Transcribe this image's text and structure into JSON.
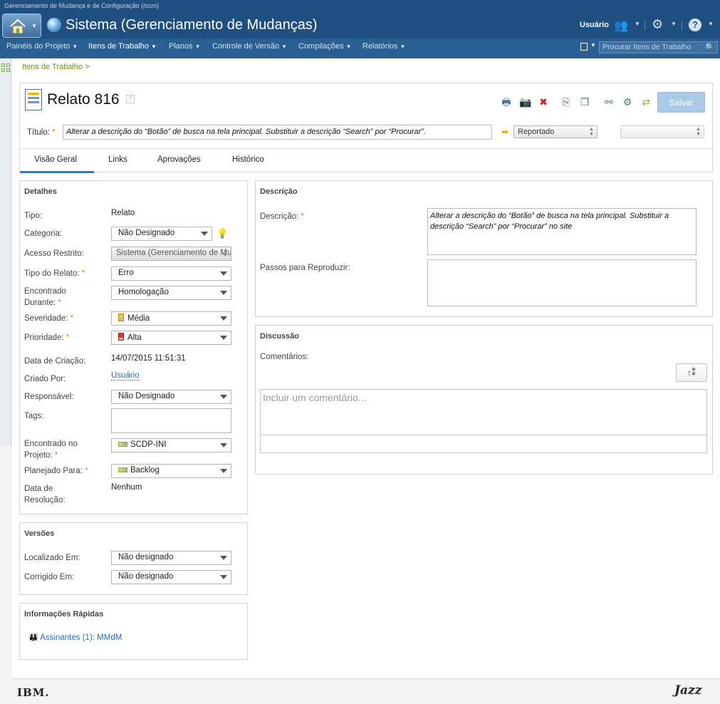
{
  "app": {
    "window_title": "Gerenciamento de Mudança e de Configuração (/ccm)",
    "project_title": "Sistema (Gerenciamento de Mudanças)",
    "user_label": "Usuário"
  },
  "nav": {
    "items": [
      {
        "label": "Painéis do Projeto"
      },
      {
        "label": "Itens de Trabalho"
      },
      {
        "label": "Planos"
      },
      {
        "label": "Controle de Versão"
      },
      {
        "label": "Compilações"
      },
      {
        "label": "Relatórios"
      }
    ],
    "search_placeholder": "Procurar Itens de Trabalho"
  },
  "breadcrumb": "Itens de Trabalho >",
  "work_item": {
    "title": "Relato 816",
    "help": "?",
    "title_label": "Título:",
    "title_value": "Alterar a descrição do “Botão” de busca na tela principal. Substituir a descrição “Search” por “Procurar”.",
    "state": "Reportado",
    "save_label": "Salvar"
  },
  "tabs": [
    {
      "label": "Visão Geral"
    },
    {
      "label": "Links"
    },
    {
      "label": "Aprovações"
    },
    {
      "label": "Histórico"
    }
  ],
  "details": {
    "header": "Detalhes",
    "fields": {
      "tipo": {
        "label": "Tipo:",
        "value": "Relato"
      },
      "categoria": {
        "label": "Categoria:",
        "value": "Não Designado"
      },
      "acesso": {
        "label": "Acesso Restrito:",
        "value": "Sistema (Gerenciamento de Mudanças)"
      },
      "tipo_relato": {
        "label": "Tipo do Relato:",
        "value": "Erro"
      },
      "encontrado_durante": {
        "label1": "Encontrado",
        "label2": "Durante:",
        "value": "Homologação"
      },
      "severidade": {
        "label": "Severidade:",
        "value": "Média"
      },
      "prioridade": {
        "label": "Prioridade:",
        "value": "Alta"
      },
      "data_criacao": {
        "label": "Data de Criação:",
        "value": "14/07/2015 11:51:31"
      },
      "criado_por": {
        "label": "Criado Por:",
        "value": "Usuário"
      },
      "responsavel": {
        "label": "Responsável:",
        "value": "Não Designado"
      },
      "tags": {
        "label": "Tags:",
        "value": ""
      },
      "encontrado_projeto": {
        "label1": "Encontrado no",
        "label2": "Projeto:",
        "value": "SCDP-INI"
      },
      "planejado_para": {
        "label": "Planejado Para:",
        "value": "Backlog"
      },
      "data_resolucao": {
        "label1": "Data de",
        "label2": "Resolução:",
        "value": "Nenhum"
      }
    }
  },
  "versions": {
    "header": "Versões",
    "localizado": {
      "label": "Localizado Em:",
      "value": "Não designado"
    },
    "corrigido": {
      "label": "Corrigido Em:",
      "value": "Não designado"
    }
  },
  "quick_info": {
    "header": "Informações Rápidas",
    "subscribers": "Assinantes (1):",
    "subscriber_name": "MMdM"
  },
  "description": {
    "header": "Descrição",
    "desc_label": "Descrição:",
    "desc_value": "Alterar a descrição do “Botão” de busca na tela principal. Substituir a descrição “Search” por “Procurar” no site",
    "steps_label": "Passos para Reproduzir:"
  },
  "discussion": {
    "header": "Discussão",
    "comments_label": "Comentários:",
    "comment_placeholder": "Incluir um comentário..."
  },
  "footer": {
    "ibm": "IBM.",
    "jazz": "Jazz"
  },
  "colors": {
    "banner": "#1f4e80",
    "nav": "#2a5f93",
    "required": "#e8761f",
    "link": "#2a6bb0",
    "breadcrumb": "#6b8f16"
  }
}
